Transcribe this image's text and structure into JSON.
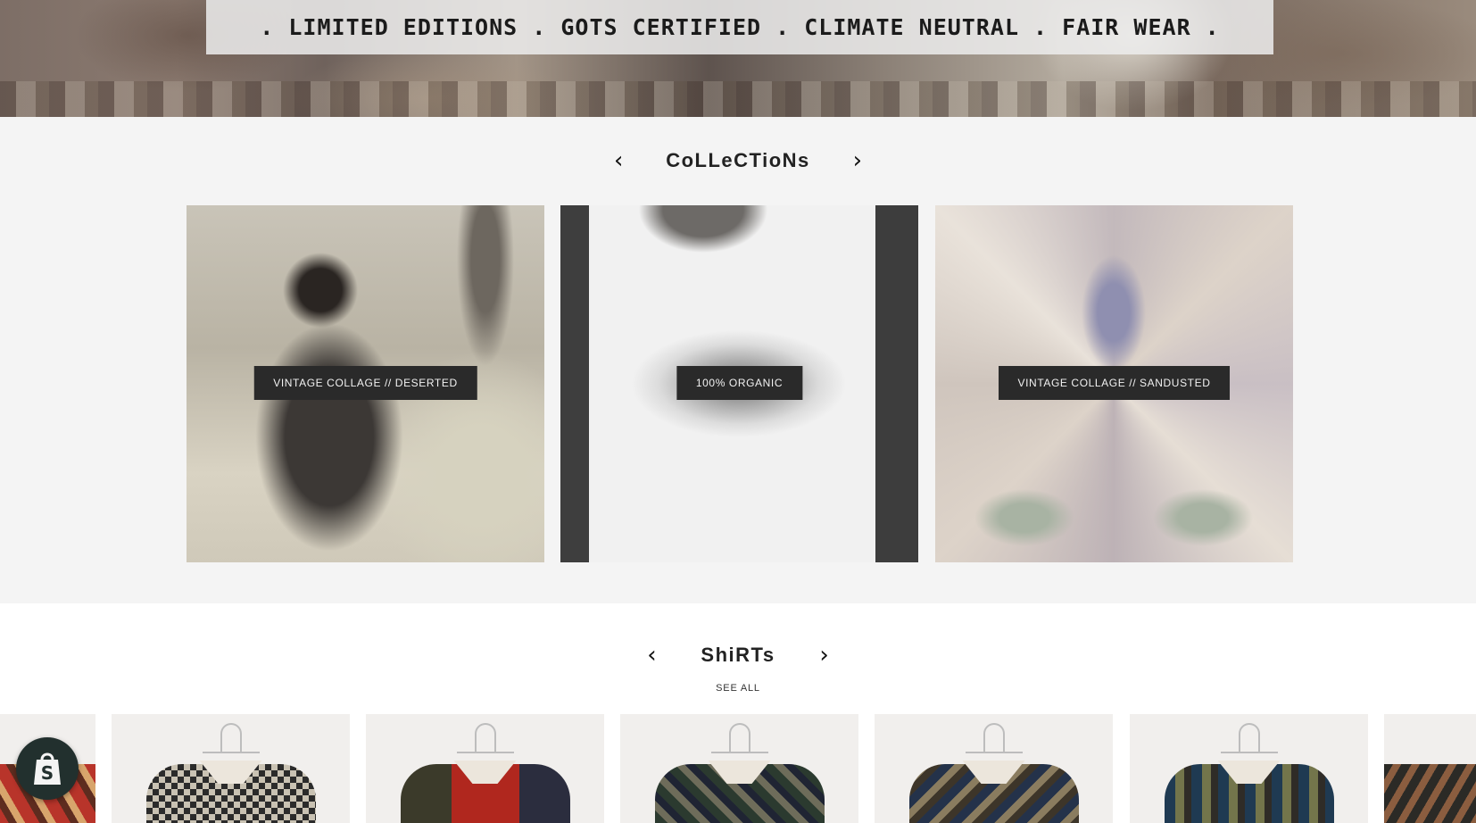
{
  "hero": {
    "banner_text": ". LIMITED EDITIONS . GOTS CERTIFIED . CLIMATE NEUTRAL . FAIR WEAR ."
  },
  "collections": {
    "title": "CoLLeCTioNs",
    "prev_icon": "chevron-left-icon",
    "next_icon": "chevron-right-icon",
    "items": [
      {
        "label": "VINTAGE COLLAGE // DESERTED"
      },
      {
        "label": "100% ORGANIC"
      },
      {
        "label": "VINTAGE COLLAGE // SANDUSTED"
      }
    ]
  },
  "shirts": {
    "title": "ShiRTs",
    "see_all": "SEE ALL",
    "prev_icon": "chevron-left-icon",
    "next_icon": "chevron-right-icon"
  },
  "shopify_badge": {
    "icon": "shopify-bag-icon",
    "color": "#22302e"
  }
}
